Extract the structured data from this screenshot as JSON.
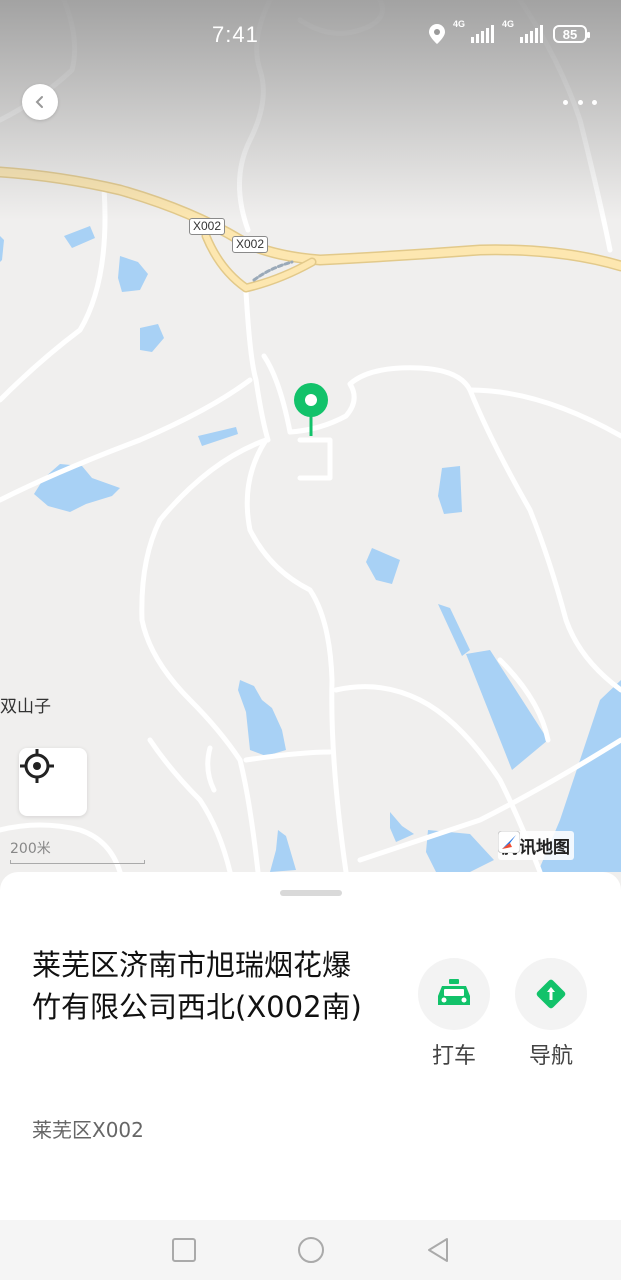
{
  "status_bar": {
    "time": "7:41",
    "network_1": "4G",
    "network_2": "4G",
    "battery": "85"
  },
  "map": {
    "road_shield_1": "X002",
    "road_shield_2": "X002",
    "place_label": "双山子",
    "scale_label": "200米",
    "logo_text": "腾讯地图",
    "colors": {
      "land": "#f0efee",
      "water": "#a8d1f5",
      "road_major": "#fde7b0",
      "road_minor": "#ffffff",
      "pin": "#12c26a"
    }
  },
  "place": {
    "title": "莱芜区济南市旭瑞烟花爆竹有限公司西北(X002南)",
    "address": "莱芜区X002"
  },
  "actions": [
    {
      "label": "打车",
      "icon": "taxi-icon"
    },
    {
      "label": "导航",
      "icon": "navigation-icon"
    }
  ],
  "nav_bar": {
    "icons": [
      "recent-apps-icon",
      "home-icon",
      "back-icon"
    ]
  }
}
